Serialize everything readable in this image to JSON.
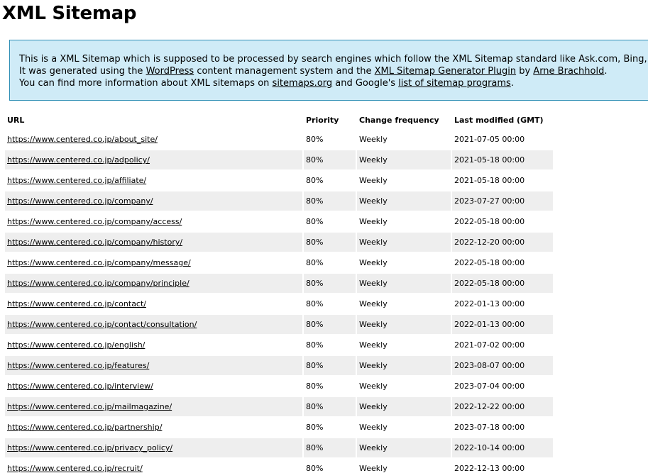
{
  "page": {
    "title": "XML Sitemap"
  },
  "intro": {
    "line1": "This is a XML Sitemap which is supposed to be processed by search engines which follow the XML Sitemap standard like Ask.com, Bing, Google and Yahoo.",
    "line2_prefix": "It was generated using the ",
    "wordpress_link": "WordPress",
    "line2_mid": " content management system and the ",
    "plugin_link": "XML Sitemap Generator Plugin",
    "line2_by": " by ",
    "author_link": "Arne Brachhold",
    "line2_end": ".",
    "line3_prefix": "You can find more information about XML sitemaps on ",
    "sitemaps_link": "sitemaps.org",
    "line3_mid": " and Google's ",
    "programs_link": "list of sitemap programs",
    "line3_end": "."
  },
  "table": {
    "headers": {
      "url": "URL",
      "priority": "Priority",
      "change_frequency": "Change frequency",
      "last_modified": "Last modified (GMT)"
    },
    "rows": [
      {
        "url": "https://www.centered.co.jp/about_site/",
        "priority": "80%",
        "freq": "Weekly",
        "modified": "2021-07-05 00:00"
      },
      {
        "url": "https://www.centered.co.jp/adpolicy/",
        "priority": "80%",
        "freq": "Weekly",
        "modified": "2021-05-18 00:00"
      },
      {
        "url": "https://www.centered.co.jp/affiliate/",
        "priority": "80%",
        "freq": "Weekly",
        "modified": "2021-05-18 00:00"
      },
      {
        "url": "https://www.centered.co.jp/company/",
        "priority": "80%",
        "freq": "Weekly",
        "modified": "2023-07-27 00:00"
      },
      {
        "url": "https://www.centered.co.jp/company/access/",
        "priority": "80%",
        "freq": "Weekly",
        "modified": "2022-05-18 00:00"
      },
      {
        "url": "https://www.centered.co.jp/company/history/",
        "priority": "80%",
        "freq": "Weekly",
        "modified": "2022-12-20 00:00"
      },
      {
        "url": "https://www.centered.co.jp/company/message/",
        "priority": "80%",
        "freq": "Weekly",
        "modified": "2022-05-18 00:00"
      },
      {
        "url": "https://www.centered.co.jp/company/principle/",
        "priority": "80%",
        "freq": "Weekly",
        "modified": "2022-05-18 00:00"
      },
      {
        "url": "https://www.centered.co.jp/contact/",
        "priority": "80%",
        "freq": "Weekly",
        "modified": "2022-01-13 00:00"
      },
      {
        "url": "https://www.centered.co.jp/contact/consultation/",
        "priority": "80%",
        "freq": "Weekly",
        "modified": "2022-01-13 00:00"
      },
      {
        "url": "https://www.centered.co.jp/english/",
        "priority": "80%",
        "freq": "Weekly",
        "modified": "2021-07-02 00:00"
      },
      {
        "url": "https://www.centered.co.jp/features/",
        "priority": "80%",
        "freq": "Weekly",
        "modified": "2023-08-07 00:00"
      },
      {
        "url": "https://www.centered.co.jp/interview/",
        "priority": "80%",
        "freq": "Weekly",
        "modified": "2023-07-04 00:00"
      },
      {
        "url": "https://www.centered.co.jp/mailmagazine/",
        "priority": "80%",
        "freq": "Weekly",
        "modified": "2022-12-22 00:00"
      },
      {
        "url": "https://www.centered.co.jp/partnership/",
        "priority": "80%",
        "freq": "Weekly",
        "modified": "2023-07-18 00:00"
      },
      {
        "url": "https://www.centered.co.jp/privacy_policy/",
        "priority": "80%",
        "freq": "Weekly",
        "modified": "2022-10-14 00:00"
      },
      {
        "url": "https://www.centered.co.jp/recruit/",
        "priority": "80%",
        "freq": "Weekly",
        "modified": "2022-12-13 00:00"
      }
    ]
  },
  "colors": {
    "intro_background": "#cfebf7",
    "intro_border": "#2f8fb5",
    "alt_row": "#eeeeee"
  }
}
